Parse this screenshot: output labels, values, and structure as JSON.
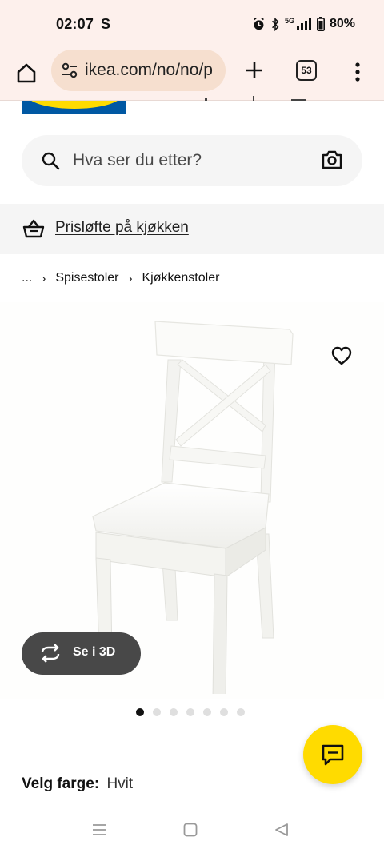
{
  "status_bar": {
    "time": "02:07",
    "carrier_icon_letter": "S",
    "network": "5G",
    "battery": "80%",
    "icons": [
      "alarm-icon",
      "bluetooth-icon",
      "signal-icon",
      "battery-icon"
    ]
  },
  "browser": {
    "url": "ikea.com/no/no/p",
    "tab_count": "53",
    "icons": [
      "home-icon",
      "site-settings-icon",
      "plus-icon",
      "tabs-icon",
      "more-icon"
    ]
  },
  "search": {
    "placeholder": "Hva ser du etter?",
    "icons": [
      "search-icon",
      "camera-icon"
    ]
  },
  "promo": {
    "label": "Prisløfte på kjøkken",
    "icon": "basket-icon"
  },
  "breadcrumb": {
    "ellipsis": "...",
    "items": [
      "Spisestoler",
      "Kjøkkenstoler"
    ]
  },
  "product": {
    "image_subject": "white wooden dining chair with cross back",
    "view_3d_label": "Se i 3D",
    "carousel_total": 7,
    "carousel_active": 1,
    "color_label": "Velg farge:",
    "color_value": "Hvit"
  },
  "colors": {
    "status_bg": "#fdf0ec",
    "url_pill": "#f6dfcf",
    "ikea_blue": "#0058a3",
    "ikea_yellow": "#ffdb00",
    "surface": "#f5f5f5",
    "button_dark": "#484848"
  }
}
